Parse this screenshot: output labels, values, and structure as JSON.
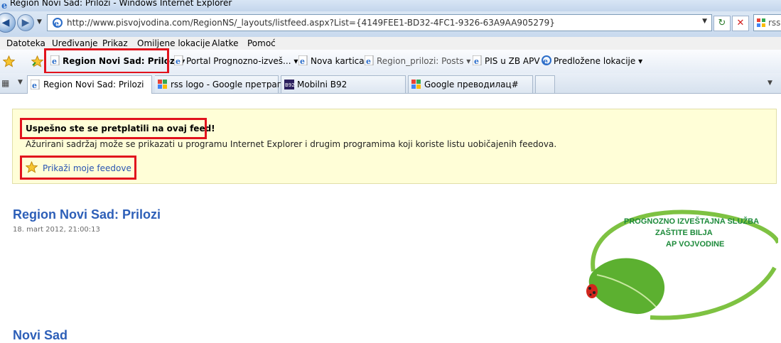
{
  "window": {
    "title": "Region Novi Sad: Prilozi - Windows Internet Explorer"
  },
  "address": {
    "url": "http://www.pisvojvodina.com/RegionNS/_layouts/listfeed.aspx?List={4149FEE1-BD32-4FC1-9326-63A9AA905279}",
    "search_text": "rss"
  },
  "menu": {
    "items": [
      "Datoteka",
      "Uređivanje",
      "Prikaz",
      "Omiljene lokacije",
      "Alatke",
      "Pomoć"
    ]
  },
  "favorites": {
    "items": [
      {
        "label": "Region Novi Sad: Prilozi ▾"
      },
      {
        "label": "Portal Prognozno-izveš... ▾"
      },
      {
        "label": "Nova kartica"
      },
      {
        "label": "Region_prilozi: Posts ▾"
      },
      {
        "label": "PIS u ZB APV"
      },
      {
        "label": "Predložene lokacije ▾"
      }
    ]
  },
  "tabs": [
    {
      "label": "Region Novi Sad: Prilozi"
    },
    {
      "label": "rss logo - Google претрага"
    },
    {
      "label": "Mobilni B92"
    },
    {
      "label": "Google преводилац#"
    }
  ],
  "banner": {
    "title": "Uspešno ste se pretplatili na ovaj feed!",
    "description": "Ažurirani sadržaj može se prikazati u programu Internet Explorer i drugim programima koji koriste listu uobičajenih feedova.",
    "link": "Prikaži moje feedove"
  },
  "feed": {
    "title": "Region Novi Sad: Prilozi",
    "date": "18. mart 2012, 21:00:13",
    "next_title_partial": "Novi Sad"
  },
  "logo": {
    "line1": "PROGNOZNO IZVEŠTAJNA SLUŽBA",
    "line2": "ZAŠTITE BILJA",
    "line3": "AP VOJVODINE"
  },
  "colors": {
    "highlight": "#e1131d",
    "link": "#2a55b3",
    "banner_bg": "#fffed7",
    "logo_green": "#1c8a3a"
  }
}
